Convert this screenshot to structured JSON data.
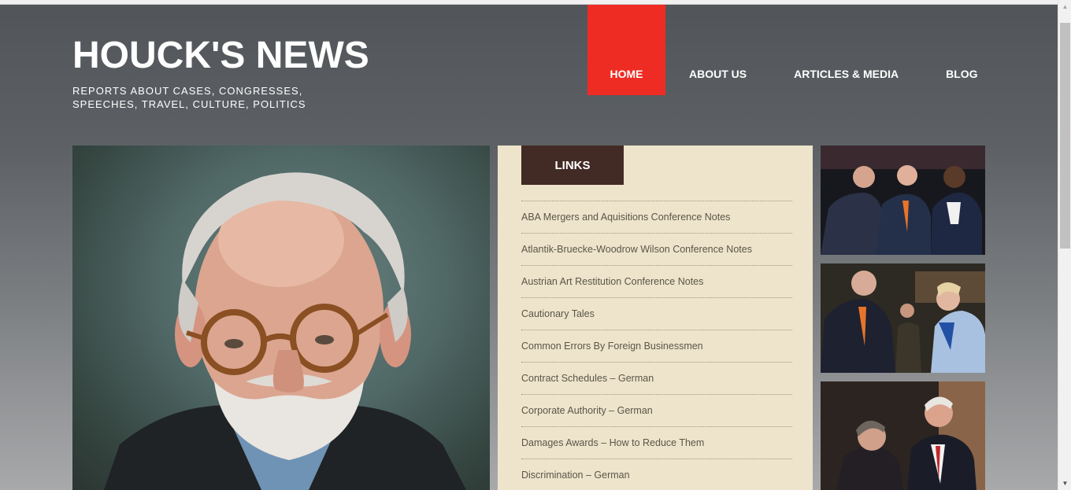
{
  "site": {
    "title": "HOUCK'S NEWS",
    "tagline": "REPORTS ABOUT CASES, CONGRESSES, SPEECHES, TRAVEL, CULTURE, POLITICS"
  },
  "nav": {
    "items": [
      {
        "label": "HOME",
        "active": true
      },
      {
        "label": "ABOUT US",
        "active": false
      },
      {
        "label": "ARTICLES & MEDIA",
        "active": false
      },
      {
        "label": "BLOG",
        "active": false
      }
    ]
  },
  "links": {
    "heading": "LINKS",
    "items": [
      "ABA Mergers and Aquisitions Conference Notes",
      "Atlantik-Bruecke-Woodrow Wilson Conference Notes",
      "Austrian Art Restitution Conference Notes",
      "Cautionary Tales",
      "Common Errors By Foreign Businessmen",
      "Contract Schedules – German",
      "Corporate Authority – German",
      "Damages Awards – How to Reduce Them",
      "Discrimination – German"
    ]
  },
  "colors": {
    "accent": "#ee2c24",
    "links_tab": "#422a25",
    "links_panel": "#ede4cb"
  }
}
